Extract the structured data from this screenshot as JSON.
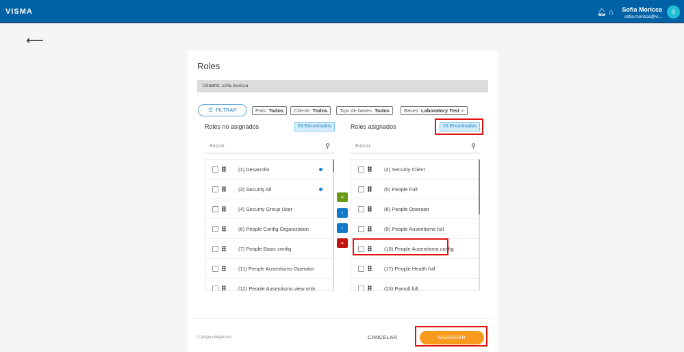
{
  "header": {
    "logo": "VISMA",
    "user_name": "Sofia Moricca",
    "user_email": "sofia.moricca@vi...",
    "avatar_initial": "S"
  },
  "page": {
    "title": "Roles",
    "user_label": "Usuario:",
    "user_value": "sofia.moricca"
  },
  "filters": {
    "button": "FILTRAR",
    "chips": [
      {
        "label": "País:",
        "value": "Todos"
      },
      {
        "label": "Cliente:",
        "value": "Todos"
      },
      {
        "label": "Tipo de bases:",
        "value": "Todos"
      },
      {
        "label": "Bases:",
        "value": "Laboratory Test",
        "close": "×"
      }
    ]
  },
  "left": {
    "title": "Roles no asignados",
    "count": "63 Encontrados",
    "search_placeholder": "Buscar",
    "items": [
      "(1) Desarrollo",
      "(3) Security All",
      "(4) Security Group User",
      "(6) People Config Organization",
      "(7) People Basic config",
      "(11) People Ausentismo Operator",
      "(12) People Ausentismo view only"
    ]
  },
  "right": {
    "title": "Roles asignados",
    "count": "16 Encontrados",
    "search_placeholder": "Buscar",
    "items": [
      "(2) Security Client",
      "(5) People Full",
      "(8) People Operator",
      "(9) People Ausentismo full",
      "(10) People Ausentismo config",
      "(17) People Health full",
      "(23) Payroll full"
    ]
  },
  "transfer": {
    "add_all": "»",
    "add": "›",
    "remove": "‹",
    "remove_all": "«"
  },
  "footer": {
    "required_note": "* Campo obligatorio",
    "cancel": "CANCELAR",
    "save": "GUARDAR"
  },
  "colors": {
    "header": "#0062a6",
    "save": "#f79a1e",
    "add_all": "#6a9a16",
    "move": "#1279c9",
    "remove_all": "#c0120e"
  }
}
